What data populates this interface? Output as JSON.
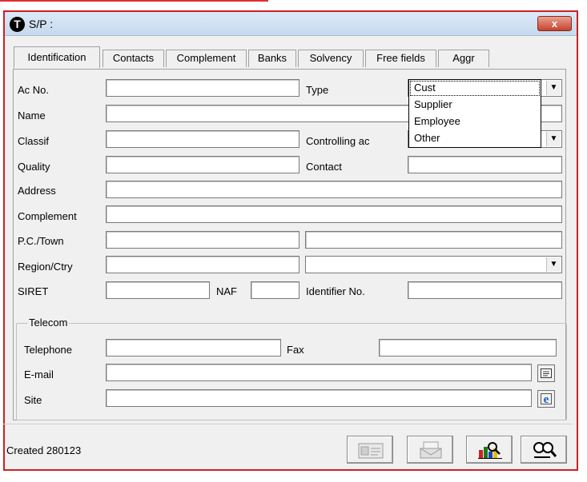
{
  "window": {
    "title": "S/P :",
    "close_label": "x"
  },
  "tabs": [
    "Identification",
    "Contacts",
    "Complement",
    "Banks",
    "Solvency",
    "Free fields",
    "Aggr"
  ],
  "labels": {
    "ac_no": "Ac No.",
    "type": "Type",
    "name": "Name",
    "classif": "Classif",
    "controlling_ac": "Controlling ac",
    "quality": "Quality",
    "contact": "Contact",
    "address": "Address",
    "complement": "Complement",
    "pc_town": "P.C./Town",
    "region_ctry": "Region/Ctry",
    "siret": "SIRET",
    "naf": "NAF",
    "identifier_no": "Identifier No."
  },
  "type_dropdown": {
    "selected": "Cust",
    "options": [
      "Cust",
      "Supplier",
      "Employee",
      "Other"
    ]
  },
  "telecom": {
    "legend": "Telecom",
    "telephone": "Telephone",
    "fax": "Fax",
    "email": "E-mail",
    "site": "Site"
  },
  "status": {
    "created": "Created 280123"
  },
  "icons": {
    "email_button": "mail-icon",
    "site_button": "ie-icon",
    "tool1": "card-icon",
    "tool2": "envelope-icon",
    "tool3": "chart-icon",
    "tool4": "search-icon"
  },
  "colors": {
    "window_border": "#cc2020",
    "title_gradient": "#dce9f7",
    "close_button": "#c6432c"
  }
}
